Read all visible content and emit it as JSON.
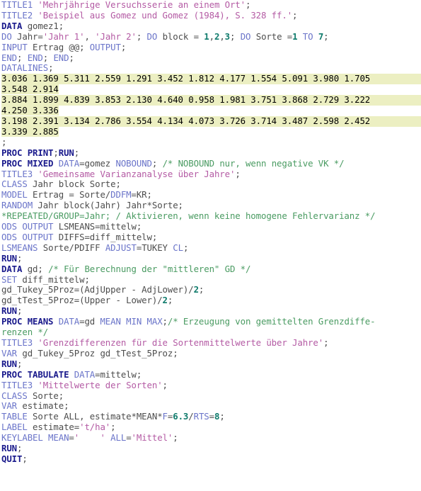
{
  "editor": {
    "language": "SAS",
    "theme": {
      "background": "#ffffff",
      "proc_keyword": "#1a1a8c",
      "statement_keyword": "#6a74c9",
      "plain_text": "#4d4d4d",
      "string_literal": "#b45ba4",
      "numeric_constant": "#0f7b6c",
      "comment": "#4a9b62",
      "datalines_highlight": "#ecefc2"
    }
  },
  "code": {
    "lines": [
      {
        "n": 1,
        "highlight": "none",
        "tokens": [
          {
            "t": "TITLE1",
            "c": "stmt"
          },
          {
            "t": " ",
            "c": "plain"
          },
          {
            "t": "'Mehrjährige Versuchsserie an einem Ort'",
            "c": "string"
          },
          {
            "t": ";",
            "c": "plain"
          }
        ]
      },
      {
        "n": 2,
        "highlight": "none",
        "tokens": [
          {
            "t": "TITLE2",
            "c": "stmt"
          },
          {
            "t": " ",
            "c": "plain"
          },
          {
            "t": "'Beispiel aus Gomez und Gomez (1984), S. 328 ff.'",
            "c": "string"
          },
          {
            "t": ";",
            "c": "plain"
          }
        ]
      },
      {
        "n": 3,
        "highlight": "none",
        "tokens": [
          {
            "t": "DATA",
            "c": "proc"
          },
          {
            "t": " gomez1;",
            "c": "plain"
          }
        ]
      },
      {
        "n": 4,
        "highlight": "none",
        "tokens": [
          {
            "t": "DO",
            "c": "stmt"
          },
          {
            "t": " Jahr=",
            "c": "plain"
          },
          {
            "t": "'Jahr 1'",
            "c": "string"
          },
          {
            "t": ", ",
            "c": "plain"
          },
          {
            "t": "'Jahr 2'",
            "c": "string"
          },
          {
            "t": "; ",
            "c": "plain"
          },
          {
            "t": "DO",
            "c": "stmt"
          },
          {
            "t": " block = ",
            "c": "plain"
          },
          {
            "t": "1",
            "c": "number"
          },
          {
            "t": ",",
            "c": "plain"
          },
          {
            "t": "2",
            "c": "number"
          },
          {
            "t": ",",
            "c": "plain"
          },
          {
            "t": "3",
            "c": "number"
          },
          {
            "t": "; ",
            "c": "plain"
          },
          {
            "t": "DO",
            "c": "stmt"
          },
          {
            "t": " Sorte =",
            "c": "plain"
          },
          {
            "t": "1",
            "c": "number"
          },
          {
            "t": " ",
            "c": "plain"
          },
          {
            "t": "TO",
            "c": "stmt"
          },
          {
            "t": " ",
            "c": "plain"
          },
          {
            "t": "7",
            "c": "number"
          },
          {
            "t": ";",
            "c": "plain"
          }
        ]
      },
      {
        "n": 5,
        "highlight": "none",
        "tokens": [
          {
            "t": "INPUT",
            "c": "stmt"
          },
          {
            "t": " Ertrag @@; ",
            "c": "plain"
          },
          {
            "t": "OUTPUT",
            "c": "stmt"
          },
          {
            "t": ";",
            "c": "plain"
          }
        ]
      },
      {
        "n": 6,
        "highlight": "none",
        "tokens": [
          {
            "t": "END",
            "c": "stmt"
          },
          {
            "t": "; ",
            "c": "plain"
          },
          {
            "t": "END",
            "c": "stmt"
          },
          {
            "t": "; ",
            "c": "plain"
          },
          {
            "t": "END",
            "c": "stmt"
          },
          {
            "t": ";",
            "c": "plain"
          }
        ]
      },
      {
        "n": 7,
        "highlight": "none",
        "tokens": [
          {
            "t": "DATALINES",
            "c": "stmt"
          },
          {
            "t": ";",
            "c": "plain"
          }
        ]
      },
      {
        "n": 8,
        "highlight": "full",
        "tokens": [
          {
            "t": "3.036 1.369 5.311 2.559 1.291 3.452 1.812 4.177 1.554 5.091 3.980 1.705",
            "c": "data"
          }
        ]
      },
      {
        "n": 9,
        "highlight": "fit",
        "tokens": [
          {
            "t": "3.548 2.914",
            "c": "data"
          }
        ]
      },
      {
        "n": 10,
        "highlight": "full",
        "tokens": [
          {
            "t": "3.884 1.899 4.839 3.853 2.130 4.640 0.958 1.981 3.751 3.868 2.729 3.222",
            "c": "data"
          }
        ]
      },
      {
        "n": 11,
        "highlight": "fit",
        "tokens": [
          {
            "t": "4.250 3.336",
            "c": "data"
          }
        ]
      },
      {
        "n": 12,
        "highlight": "full",
        "tokens": [
          {
            "t": "3.198 2.391 3.134 2.786 3.554 4.134 4.073 3.726 3.714 3.487 2.598 2.452",
            "c": "data"
          }
        ]
      },
      {
        "n": 13,
        "highlight": "fit",
        "tokens": [
          {
            "t": "3.339 2.885",
            "c": "data"
          }
        ]
      },
      {
        "n": 14,
        "highlight": "none",
        "tokens": [
          {
            "t": ";",
            "c": "plain"
          }
        ]
      },
      {
        "n": 15,
        "highlight": "none",
        "tokens": [
          {
            "t": "PROC PRINT",
            "c": "proc"
          },
          {
            "t": ";",
            "c": "plain"
          },
          {
            "t": "RUN",
            "c": "proc"
          },
          {
            "t": ";",
            "c": "plain"
          }
        ]
      },
      {
        "n": 16,
        "highlight": "none",
        "tokens": [
          {
            "t": "PROC MIXED",
            "c": "proc"
          },
          {
            "t": " ",
            "c": "plain"
          },
          {
            "t": "DATA",
            "c": "opt"
          },
          {
            "t": "=gomez ",
            "c": "plain"
          },
          {
            "t": "NOBOUND",
            "c": "opt"
          },
          {
            "t": "; ",
            "c": "plain"
          },
          {
            "t": "/* NOBOUND nur, wenn negative VK */",
            "c": "comment"
          }
        ]
      },
      {
        "n": 17,
        "highlight": "none",
        "tokens": [
          {
            "t": "TITLE3",
            "c": "stmt"
          },
          {
            "t": " ",
            "c": "plain"
          },
          {
            "t": "'Gemeinsame Varianzanalyse über Jahre'",
            "c": "string"
          },
          {
            "t": ";",
            "c": "plain"
          }
        ]
      },
      {
        "n": 18,
        "highlight": "none",
        "tokens": [
          {
            "t": "CLASS",
            "c": "stmt"
          },
          {
            "t": " Jahr block Sorte;",
            "c": "plain"
          }
        ]
      },
      {
        "n": 19,
        "highlight": "none",
        "tokens": [
          {
            "t": "MODEL",
            "c": "stmt"
          },
          {
            "t": " Ertrag = Sorte/",
            "c": "plain"
          },
          {
            "t": "DDFM",
            "c": "opt"
          },
          {
            "t": "=KR;",
            "c": "plain"
          }
        ]
      },
      {
        "n": 20,
        "highlight": "none",
        "tokens": [
          {
            "t": "RANDOM",
            "c": "stmt"
          },
          {
            "t": " Jahr block(Jahr) Jahr*Sorte;",
            "c": "plain"
          }
        ]
      },
      {
        "n": 21,
        "highlight": "none",
        "tokens": [
          {
            "t": "*REPEATED/GROUP=Jahr; / Aktivieren, wenn keine homogene Fehlervarianz */",
            "c": "comment"
          }
        ]
      },
      {
        "n": 22,
        "highlight": "none",
        "tokens": [
          {
            "t": "ODS OUTPUT",
            "c": "stmt"
          },
          {
            "t": " LSMEANS=mittelw;",
            "c": "plain"
          }
        ]
      },
      {
        "n": 23,
        "highlight": "none",
        "tokens": [
          {
            "t": "ODS OUTPUT",
            "c": "stmt"
          },
          {
            "t": " DIFFS=diff_mittelw;",
            "c": "plain"
          }
        ]
      },
      {
        "n": 24,
        "highlight": "none",
        "tokens": [
          {
            "t": "LSMEANS",
            "c": "stmt"
          },
          {
            "t": " Sorte/PDIFF ",
            "c": "plain"
          },
          {
            "t": "ADJUST",
            "c": "opt"
          },
          {
            "t": "=TUKEY ",
            "c": "plain"
          },
          {
            "t": "CL",
            "c": "opt"
          },
          {
            "t": ";",
            "c": "plain"
          }
        ]
      },
      {
        "n": 25,
        "highlight": "none",
        "tokens": [
          {
            "t": "RUN",
            "c": "proc"
          },
          {
            "t": ";",
            "c": "plain"
          }
        ]
      },
      {
        "n": 26,
        "highlight": "none",
        "tokens": [
          {
            "t": "DATA",
            "c": "proc"
          },
          {
            "t": " gd; ",
            "c": "plain"
          },
          {
            "t": "/* Für Berechnung der \"mittleren\" GD */",
            "c": "comment"
          }
        ]
      },
      {
        "n": 27,
        "highlight": "none",
        "tokens": [
          {
            "t": "SET",
            "c": "stmt"
          },
          {
            "t": " diff_mittelw;",
            "c": "plain"
          }
        ]
      },
      {
        "n": 28,
        "highlight": "none",
        "tokens": [
          {
            "t": "gd_Tukey_5Proz=(AdjUpper - AdjLower)/",
            "c": "plain"
          },
          {
            "t": "2",
            "c": "number"
          },
          {
            "t": ";",
            "c": "plain"
          }
        ]
      },
      {
        "n": 29,
        "highlight": "none",
        "tokens": [
          {
            "t": "gd_tTest_5Proz=(Upper - Lower)/",
            "c": "plain"
          },
          {
            "t": "2",
            "c": "number"
          },
          {
            "t": ";",
            "c": "plain"
          }
        ]
      },
      {
        "n": 30,
        "highlight": "none",
        "tokens": [
          {
            "t": "RUN",
            "c": "proc"
          },
          {
            "t": ";",
            "c": "plain"
          }
        ]
      },
      {
        "n": 31,
        "highlight": "none",
        "tokens": [
          {
            "t": "PROC MEANS",
            "c": "proc"
          },
          {
            "t": " ",
            "c": "plain"
          },
          {
            "t": "DATA",
            "c": "opt"
          },
          {
            "t": "=gd ",
            "c": "plain"
          },
          {
            "t": "MEAN MIN MAX",
            "c": "opt"
          },
          {
            "t": ";",
            "c": "plain"
          },
          {
            "t": "/* Erzeugung von gemittelten Grenzdiffe-",
            "c": "comment"
          }
        ]
      },
      {
        "n": 32,
        "highlight": "none",
        "tokens": [
          {
            "t": "renzen */",
            "c": "comment"
          }
        ]
      },
      {
        "n": 33,
        "highlight": "none",
        "tokens": [
          {
            "t": "TITLE3",
            "c": "stmt"
          },
          {
            "t": " ",
            "c": "plain"
          },
          {
            "t": "'Grenzdifferenzen für die Sortenmittelwerte über Jahre'",
            "c": "string"
          },
          {
            "t": ";",
            "c": "plain"
          }
        ]
      },
      {
        "n": 34,
        "highlight": "none",
        "tokens": [
          {
            "t": "VAR",
            "c": "stmt"
          },
          {
            "t": " gd_Tukey_5Proz gd_tTest_5Proz;",
            "c": "plain"
          }
        ]
      },
      {
        "n": 35,
        "highlight": "none",
        "tokens": [
          {
            "t": "RUN",
            "c": "proc"
          },
          {
            "t": ";",
            "c": "plain"
          }
        ]
      },
      {
        "n": 36,
        "highlight": "none",
        "tokens": [
          {
            "t": "PROC TABULATE",
            "c": "proc"
          },
          {
            "t": " ",
            "c": "plain"
          },
          {
            "t": "DATA",
            "c": "opt"
          },
          {
            "t": "=mittelw;",
            "c": "plain"
          }
        ]
      },
      {
        "n": 37,
        "highlight": "none",
        "tokens": [
          {
            "t": "TITLE3",
            "c": "stmt"
          },
          {
            "t": " ",
            "c": "plain"
          },
          {
            "t": "'Mittelwerte der Sorten'",
            "c": "string"
          },
          {
            "t": ";",
            "c": "plain"
          }
        ]
      },
      {
        "n": 38,
        "highlight": "none",
        "tokens": [
          {
            "t": "CLASS",
            "c": "stmt"
          },
          {
            "t": " Sorte;",
            "c": "plain"
          }
        ]
      },
      {
        "n": 39,
        "highlight": "none",
        "tokens": [
          {
            "t": "VAR",
            "c": "stmt"
          },
          {
            "t": " estimate;",
            "c": "plain"
          }
        ]
      },
      {
        "n": 40,
        "highlight": "none",
        "tokens": [
          {
            "t": "TABLE",
            "c": "stmt"
          },
          {
            "t": " Sorte ALL, estimate*MEAN*",
            "c": "plain"
          },
          {
            "t": "F",
            "c": "opt"
          },
          {
            "t": "=",
            "c": "plain"
          },
          {
            "t": "6.3",
            "c": "number"
          },
          {
            "t": "/",
            "c": "plain"
          },
          {
            "t": "RTS",
            "c": "opt"
          },
          {
            "t": "=",
            "c": "plain"
          },
          {
            "t": "8",
            "c": "number"
          },
          {
            "t": ";",
            "c": "plain"
          }
        ]
      },
      {
        "n": 41,
        "highlight": "none",
        "tokens": [
          {
            "t": "LABEL",
            "c": "stmt"
          },
          {
            "t": " estimate=",
            "c": "plain"
          },
          {
            "t": "'t/ha'",
            "c": "string"
          },
          {
            "t": ";",
            "c": "plain"
          }
        ]
      },
      {
        "n": 42,
        "highlight": "none",
        "tokens": [
          {
            "t": "KEYLABEL MEAN",
            "c": "stmt"
          },
          {
            "t": "=",
            "c": "plain"
          },
          {
            "t": "'    '",
            "c": "string"
          },
          {
            "t": " ",
            "c": "plain"
          },
          {
            "t": "ALL",
            "c": "stmt"
          },
          {
            "t": "=",
            "c": "plain"
          },
          {
            "t": "'Mittel'",
            "c": "string"
          },
          {
            "t": ";",
            "c": "plain"
          }
        ]
      },
      {
        "n": 43,
        "highlight": "none",
        "tokens": [
          {
            "t": "RUN",
            "c": "proc"
          },
          {
            "t": ";",
            "c": "plain"
          }
        ]
      },
      {
        "n": 44,
        "highlight": "none",
        "tokens": [
          {
            "t": "QUIT",
            "c": "proc"
          },
          {
            "t": ";",
            "c": "plain"
          }
        ]
      }
    ]
  }
}
